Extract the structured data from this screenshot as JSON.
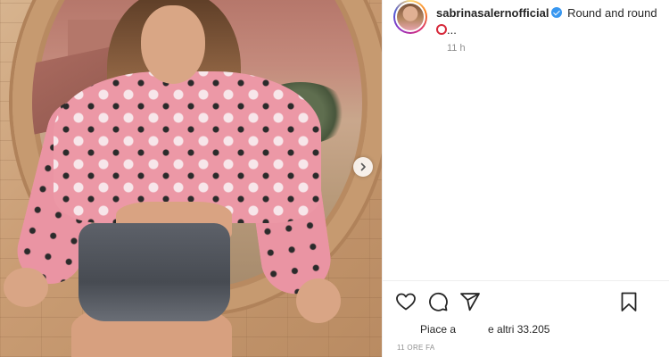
{
  "post": {
    "username": "sabrinasalernofficial",
    "caption_text": "Round and round",
    "caption_suffix": "...",
    "time_ago": "11 h",
    "likes_prefix": "Piace a",
    "likes_suffix": "e altri 33.205",
    "timestamp": "11 ORE FA"
  },
  "icons": {
    "verified": "verified-badge-icon",
    "emoji": "red-circle-emoji",
    "like": "heart-icon",
    "comment": "comment-icon",
    "share": "share-icon",
    "save": "bookmark-icon",
    "next": "chevron-right-icon"
  },
  "colors": {
    "verified_blue": "#3897f0",
    "text": "#262626",
    "muted": "#8e8e8e",
    "divider": "#efefef"
  }
}
